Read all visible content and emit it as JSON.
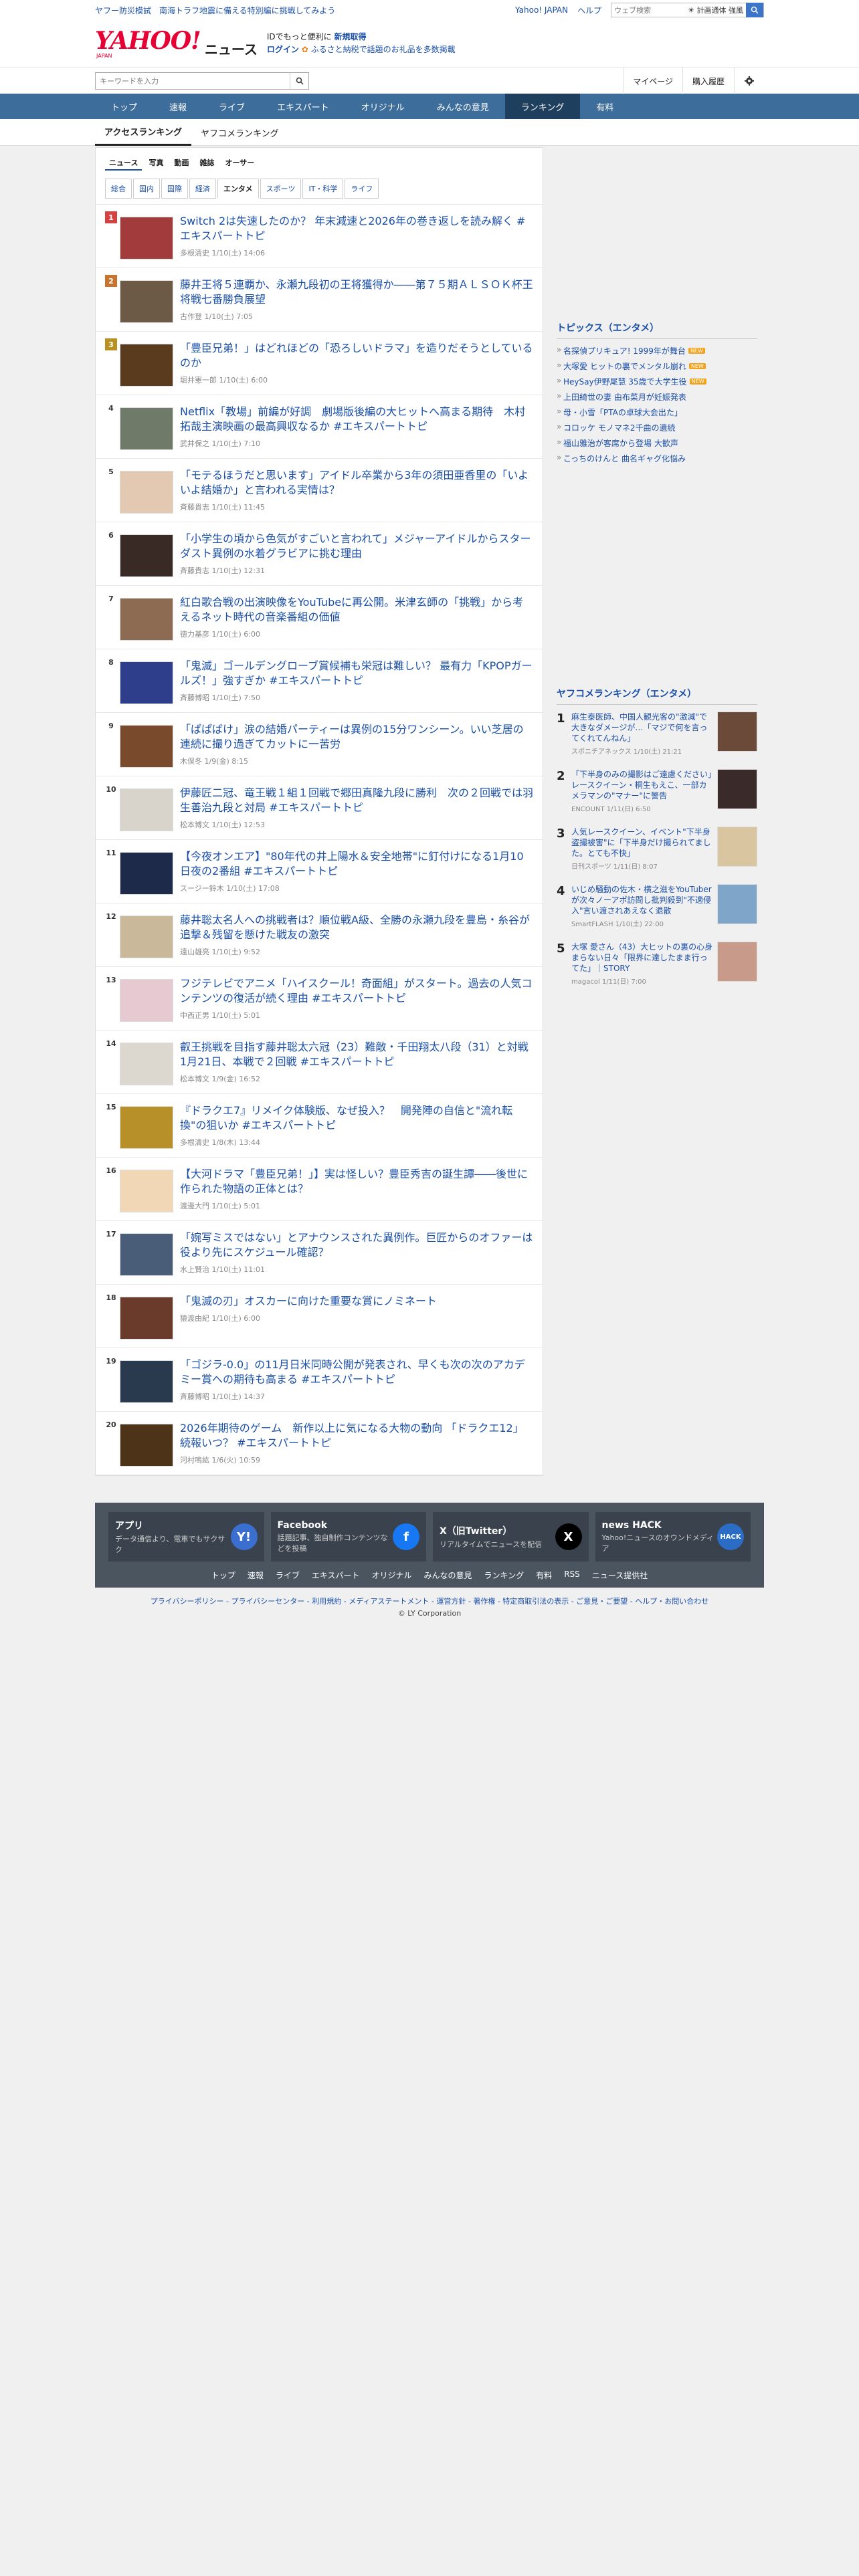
{
  "topstrip": {
    "announce": "ヤフー防災模試　南海トラフ地震に備える特別編に挑戦してみよう",
    "yahoo_japan": "Yahoo! JAPAN",
    "help": "ヘルプ",
    "search_placeholder": "ウェブ検索",
    "weather": "☀ 計画通体 強風",
    "search_icon": "search-icon"
  },
  "header": {
    "logo_text": "YAHOO!",
    "logo_sub": "JAPAN",
    "service": "ニュース",
    "promo_line1_a": "IDでもっと便利に",
    "promo_line1_b": "新規取得",
    "promo_line2_a": "ログイン",
    "promo_line2_b": "ふるさと納税で話題のお礼品を多数掲載"
  },
  "searchrow": {
    "placeholder": "キーワードを入力",
    "mypage": "マイページ",
    "history": "購入履歴",
    "settings_icon": "gear-icon"
  },
  "nav": {
    "tabs": [
      "トップ",
      "速報",
      "ライブ",
      "エキスパート",
      "オリジナル",
      "みんなの意見",
      "ランキング",
      "有料"
    ],
    "active": "ランキング"
  },
  "subtabs": {
    "items": [
      "アクセスランキング",
      "ヤフコメランキング"
    ],
    "active": "アクセスランキング"
  },
  "typetabs": {
    "items": [
      "ニュース",
      "写真",
      "動画",
      "雑誌",
      "オーサー"
    ],
    "active": "ニュース"
  },
  "cattabs": {
    "items": [
      "総合",
      "国内",
      "国際",
      "経済",
      "エンタメ",
      "スポーツ",
      "IT・科学",
      "ライフ"
    ],
    "active": "エンタメ"
  },
  "ranking": [
    {
      "n": "1",
      "title": "Switch 2は失速したのか？ 年末減速と2026年の巻き返しを読み解く #エキスパートトピ",
      "meta": "多根清史  1/10(土) 14:06",
      "color": "#a23b3b"
    },
    {
      "n": "2",
      "title": "藤井王将５連覇か、永瀬九段初の王将獲得か――第７５期ＡＬＳＯＫ杯王将戦七番勝負展望",
      "meta": "古作登  1/10(土) 7:05",
      "color": "#6d5a46"
    },
    {
      "n": "3",
      "title": "「豊臣兄弟！」はどれほどの「恐ろしいドラマ」を造りだそうとしているのか",
      "meta": "堀井憲一郎  1/10(土) 6:00",
      "color": "#5b3b1e"
    },
    {
      "n": "4",
      "title": "Netflix「教場」前編が好調　劇場版後編の大ヒットへ高まる期待　木村拓哉主演映画の最高興収なるか #エキスパートトピ",
      "meta": "武井保之  1/10(土) 7:10",
      "color": "#6f7a68"
    },
    {
      "n": "5",
      "title": "「モテるほうだと思います」アイドル卒業から3年の須田亜香里の「いよいよ結婚か」と言われる実情は？",
      "meta": "斉藤貴志  1/10(土) 11:45",
      "color": "#e4c9b2"
    },
    {
      "n": "6",
      "title": "「小学生の頃から色気がすごいと言われて」メジャーアイドルからスターダスト異例の水着グラビアに挑む理由",
      "meta": "斉藤貴志  1/10(土) 12:31",
      "color": "#3a2a26"
    },
    {
      "n": "7",
      "title": "紅白歌合戦の出演映像をYouTubeに再公開。米津玄師の「挑戦」から考えるネット時代の音楽番組の価値",
      "meta": "徳力基彦  1/10(土) 6:00",
      "color": "#8c6b52"
    },
    {
      "n": "8",
      "title": "「鬼滅」ゴールデングローブ賞候補も栄冠は難しい？ 最有力「KPOPガールズ！」強すぎか #エキスパートトピ",
      "meta": "斉藤博昭  1/10(土) 7:50",
      "color": "#2e3e8a"
    },
    {
      "n": "9",
      "title": "「ぱぱばけ」涙の結婚パーティーは異例の15分ワンシーン。いい芝居の連続に撮り過ぎてカットに一苦労",
      "meta": "木俣冬  1/9(金) 8:15",
      "color": "#7a4a2c"
    },
    {
      "n": "10",
      "title": "伊藤匠二冠、竜王戦１組１回戦で郷田真隆九段に勝利　次の２回戦では羽生善治九段と対局 #エキスパートトピ",
      "meta": "松本博文  1/10(土) 12:53",
      "color": "#d8d4cc"
    },
    {
      "n": "11",
      "title": "【今夜オンエア】\"80年代の井上陽水＆安全地帯\"に釘付けになる1月10日夜の2番組 #エキスパートトピ",
      "meta": "スージー鈴木  1/10(土) 17:08",
      "color": "#1e2a4a"
    },
    {
      "n": "12",
      "title": "藤井聡太名人への挑戦者は？順位戦A級、全勝の永瀬九段を豊島・糸谷が追撃＆残留を懸けた戦友の激突",
      "meta": "遠山雄亮  1/10(土) 9:52",
      "color": "#c9b99a"
    },
    {
      "n": "13",
      "title": "フジテレビでアニメ「ハイスクール！奇面組」がスタート。過去の人気コンテンツの復活が続く理由 #エキスパートトピ",
      "meta": "中西正男  1/10(土) 5:01",
      "color": "#e7c9d2"
    },
    {
      "n": "14",
      "title": "叡王挑戦を目指す藤井聡太六冠（23）難敵・千田翔太八段（31）と対戦　1月21日、本戦で２回戦 #エキスパートトピ",
      "meta": "松本博文  1/9(金) 16:52",
      "color": "#ddd8cf"
    },
    {
      "n": "15",
      "title": "『ドラクエ7』リメイク体験版、なぜ投入？　開発陣の自信と\"流れ転換\"の狙いか #エキスパートトピ",
      "meta": "多根清史  1/8(木) 13:44",
      "color": "#b8902a"
    },
    {
      "n": "16",
      "title": "【大河ドラマ「豊臣兄弟！」】実は怪しい？豊臣秀吉の誕生譚――後世に作られた物語の正体とは？",
      "meta": "渡邊大門  1/10(土) 5:01",
      "color": "#f1d7b6"
    },
    {
      "n": "17",
      "title": "「婉写ミスではない」とアナウンスされた異例作。巨匠からのオファーは役より先にスケジュール確認？",
      "meta": "水上賢治  1/10(土) 11:01",
      "color": "#4a5d78"
    },
    {
      "n": "18",
      "title": "「鬼滅の刃」オスカーに向けた重要な賞にノミネート",
      "meta": "猿渡由紀  1/10(土) 6:00",
      "color": "#6a3a2a"
    },
    {
      "n": "19",
      "title": "「ゴジラ-0.0」の11月日米同時公開が発表され、早くも次の次のアカデミー賞への期待も高まる #エキスパートトピ",
      "meta": "斉藤博昭  1/10(土) 14:37",
      "color": "#2a3a4e"
    },
    {
      "n": "20",
      "title": "2026年期待のゲーム　新作以上に気になる大物の動向 「ドラクエ12」続報いつ？ #エキスパートトピ",
      "meta": "河村鳴紘  1/6(火) 10:59",
      "color": "#4d3418"
    }
  ],
  "topics": {
    "heading": "トピックス（エンタメ）",
    "items": [
      {
        "text": "名探偵プリキュア! 1999年が舞台",
        "new": "NEW"
      },
      {
        "text": "大塚愛 ヒットの裏でメンタル崩れ",
        "new": "NEW"
      },
      {
        "text": "HeySay伊野尾慧 35歳で大学生役",
        "new": "NEW"
      },
      {
        "text": "上田綺世の妻 由布菜月が妊娠発表",
        "new": ""
      },
      {
        "text": "母・小雪「PTAの卓球大会出た」",
        "new": ""
      },
      {
        "text": "コロッケ モノマネ2千曲の遺続",
        "new": ""
      },
      {
        "text": "福山雅治が客席から登場 大歓声",
        "new": ""
      },
      {
        "text": "こっちのけんと 曲名ギャグ化悩み",
        "new": ""
      }
    ]
  },
  "yahoo_comment_ranking": {
    "heading": "ヤフコメランキング（エンタメ）",
    "items": [
      {
        "n": "1",
        "title": "麻生泰医師、中国人観光客の\"激減\"で大きなダメージが…「マジで何を言ってくれてんねん」",
        "meta": "スポニチアネックス 1/10(土) 21:21",
        "color": "#6b4a3a"
      },
      {
        "n": "2",
        "title": "「下半身のみの撮影はご遠慮ください」レースクイーン・桐生もえこ、一部カメラマンの\"マナー\"に警告",
        "meta": "ENCOUNT 1/11(日) 6:50",
        "color": "#3a2a2a"
      },
      {
        "n": "3",
        "title": "人気レースクイーン、イベント\"下半身盗撮被害\"に「下半身だけ撮られてました。とても不快」",
        "meta": "日刊スポーツ 1/11(日) 8:07",
        "color": "#d9c6a0"
      },
      {
        "n": "4",
        "title": "いじめ騒動の佐木・横之滋をYouTuberが次々ノーアポ訪問し批判殺到\"不適侵入\"言い渡されあえなく退散",
        "meta": "SmartFLASH 1/10(土) 22:00",
        "color": "#7fa6c8"
      },
      {
        "n": "5",
        "title": "大塚 愛さん（43）大ヒットの裏の心身まらない日々「限界に達したまま行ってた」｜STORY",
        "meta": "magacol 1/11(日) 7:00",
        "color": "#c79a8a"
      }
    ]
  },
  "app_footer": {
    "cards": [
      {
        "title": "アプリ",
        "desc": "データ通信より、電車でもサクサク",
        "icon": "Y!",
        "color": "#3a6fd0"
      },
      {
        "title": "Facebook",
        "desc": "話題記事、独自制作コンテンツなどを投稿",
        "icon": "f",
        "color": "#1877f2"
      },
      {
        "title": "X（旧Twitter）",
        "desc": "リアルタイムでニュースを配信",
        "icon": "X",
        "color": "#000000"
      },
      {
        "title": "news HACK",
        "desc": "Yahoo!ニュースのオウンドメディア",
        "icon": "HACK",
        "color": "#2b6cc4"
      }
    ],
    "links": [
      "トップ",
      "速報",
      "ライブ",
      "エキスパート",
      "オリジナル",
      "みんなの意見",
      "ランキング",
      "有料",
      "RSS",
      "ニュース提供社"
    ]
  },
  "legal": "プライバシーポリシー - プライバシーセンター - 利用規約 - メディアステートメント - 運営方針 - 著作権 - 特定商取引法の表示 - ご意見・ご要望 - ヘルプ・お問い合わせ",
  "copyright": "© LY Corporation"
}
